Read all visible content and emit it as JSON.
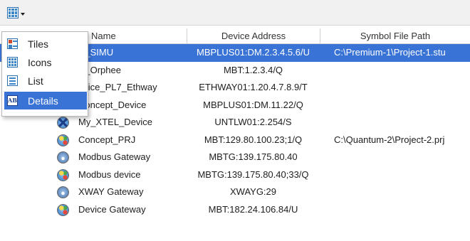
{
  "toolbar": {
    "view_button_icon": "grid-view-icon",
    "dropdown_icon": "caret-down-icon"
  },
  "columns": {
    "name": "Name",
    "device_address": "Device Address",
    "symbol_file_path": "Symbol File Path"
  },
  "rows": [
    {
      "name": "C_SIMU",
      "address": "MBPLUS01:DM.2.3.4.5.6/U",
      "symbol": "C:\\Premium-1\\Project-1.stu",
      "icon": "globe-icon",
      "selected": true
    },
    {
      "name": "C_Orphee",
      "address": "MBT:1.2.3.4/Q",
      "symbol": "",
      "icon": "globe-icon",
      "selected": false
    },
    {
      "name": "evice_PL7_Ethway",
      "address": "ETHWAY01:1.20.4.7.8.9/T",
      "symbol": "",
      "icon": "globe-icon",
      "selected": false
    },
    {
      "name": "Concept_Device",
      "address": "MBPLUS01:DM.11.22/Q",
      "symbol": "",
      "icon": "globe-icon",
      "selected": false
    },
    {
      "name": "My_XTEL_Device",
      "address": "UNTLW01:2.254/S",
      "symbol": "",
      "icon": "globe-x-icon",
      "selected": false
    },
    {
      "name": "Concept_PRJ",
      "address": "MBT:129.80.100.23;1/Q",
      "symbol": "C:\\Quantum-2\\Project-2.prj",
      "icon": "globe-icon",
      "selected": false
    },
    {
      "name": "Modbus Gateway",
      "address": "MBTG:139.175.80.40",
      "symbol": "",
      "icon": "gateway-icon",
      "selected": false
    },
    {
      "name": "Modbus device",
      "address": "MBTG:139.175.80.40;33/Q",
      "symbol": "",
      "icon": "globe-icon",
      "selected": false
    },
    {
      "name": "XWAY Gateway",
      "address": "XWAYG:29",
      "symbol": "",
      "icon": "gateway-icon",
      "selected": false
    },
    {
      "name": "Device Gateway",
      "address": "MBT:182.24.106.84/U",
      "symbol": "",
      "icon": "globe-icon",
      "selected": false
    }
  ],
  "view_menu": {
    "items": [
      {
        "label": "Tiles",
        "icon": "tiles-icon",
        "selected": false
      },
      {
        "label": "Icons",
        "icon": "icons-icon",
        "selected": false
      },
      {
        "label": "List",
        "icon": "list-icon",
        "selected": false
      },
      {
        "label": "Details",
        "icon": "details-icon",
        "selected": true
      }
    ]
  },
  "colors": {
    "selection": "#3a73d6",
    "toolbar_bg": "#f1f1f1"
  }
}
